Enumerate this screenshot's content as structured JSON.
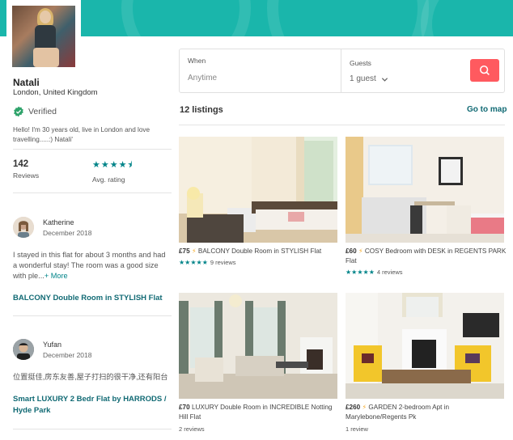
{
  "host": {
    "name": "Natali",
    "location": "London, United Kingdom",
    "verified_label": "Verified",
    "about": "Hello!  I'm 30 years old, live in London and love travelling.....:)  Natali'",
    "reviews_count": "142",
    "reviews_label": "Reviews",
    "avg_rating_label": "Avg. rating",
    "avg_rating_stars": "★★★★⯨",
    "avg_rating_value": 4.5
  },
  "reviews": [
    {
      "name": "Katherine",
      "date": "December 2018",
      "text": "I stayed in this flat for about 3 months and had a wonderful stay! The room was a good size with ple...",
      "more": "+ More",
      "listing": "BALCONY Double Room in STYLISH Flat"
    },
    {
      "name": "Yufan",
      "date": "December 2018",
      "text": "位置挺佳,房东友善,屋子打扫的很干净,还有阳台",
      "listing": "Smart LUXURY 2 Bedr Flat by HARRODS / Hyde Park"
    }
  ],
  "search": {
    "when_label": "When",
    "when_placeholder": "Anytime",
    "guests_label": "Guests",
    "guests_value": "1 guest"
  },
  "listings_header": {
    "count": "12 listings",
    "map_link": "Go to map"
  },
  "listings": [
    {
      "price": "£75",
      "title": "BALCONY Double Room in STYLISH Flat",
      "stars": "★★★★★",
      "reviews": "9 reviews",
      "rating": 5
    },
    {
      "price": "£60",
      "title": "COSY Bedroom with DESK in REGENTS PARK Flat",
      "stars": "★★★★★",
      "reviews": "4 reviews",
      "rating": 5
    },
    {
      "price": "£70",
      "title": "LUXURY Double Room in INCREDIBLE Notting Hill Flat",
      "reviews": "2 reviews"
    },
    {
      "price": "£260",
      "title": "GARDEN 2-bedroom Apt in Marylebone/Regents Pk",
      "reviews": "1 review"
    }
  ],
  "colors": {
    "banner": "#1ab6ab",
    "link": "#116a74",
    "star": "#008489",
    "search_button": "#ff5a5f"
  },
  "icons": [
    "verified-check-icon",
    "search-icon",
    "chevron-down-icon",
    "instant-book-bolt-icon",
    "star-icon"
  ]
}
